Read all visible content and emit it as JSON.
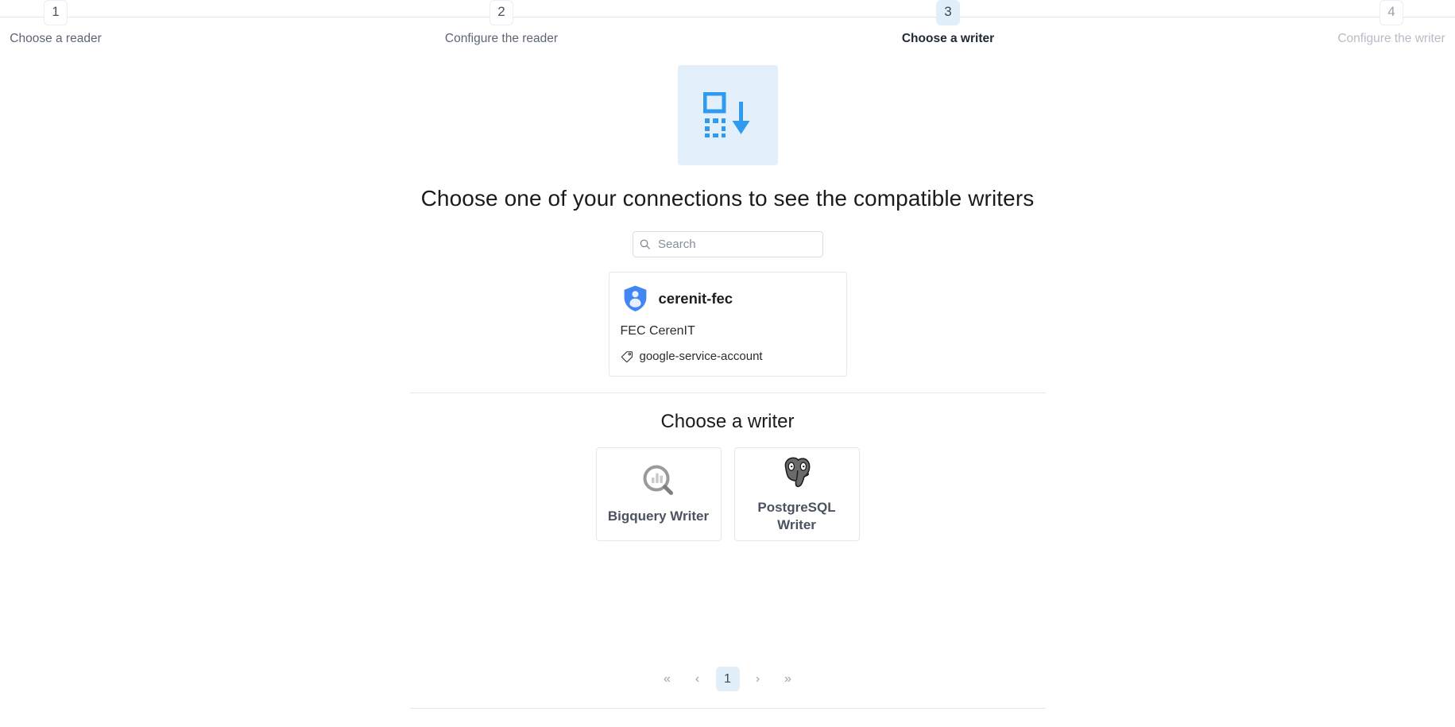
{
  "stepper": {
    "steps": [
      {
        "number": "1",
        "label": "Choose a reader",
        "state": "done"
      },
      {
        "number": "2",
        "label": "Configure the reader",
        "state": "done"
      },
      {
        "number": "3",
        "label": "Choose a writer",
        "state": "active"
      },
      {
        "number": "4",
        "label": "Configure the writer",
        "state": "upcoming"
      }
    ]
  },
  "hero": {
    "icon": "dataset-download-icon",
    "background_color": "#e3f0fc",
    "accent_color": "#2e9bf0"
  },
  "main": {
    "title": "Choose one of your connections to see the compatible writers",
    "search": {
      "placeholder": "Search",
      "value": "",
      "icon": "search-icon"
    },
    "connections": [
      {
        "icon": "shield-user-icon",
        "name": "cerenit-fec",
        "description": "FEC CerenIT",
        "tag_icon": "tag-icon",
        "tag": "google-service-account"
      }
    ],
    "writers_section_title": "Choose a writer",
    "writers": [
      {
        "icon": "bigquery-icon",
        "label": "Bigquery Writer"
      },
      {
        "icon": "postgresql-elephant-icon",
        "label": "PostgreSQL Writer"
      }
    ]
  },
  "pagination": {
    "first_label": "«",
    "prev_label": "‹",
    "pages": [
      "1"
    ],
    "current_page": "1",
    "next_label": "›",
    "last_label": "»",
    "active_background": "#e1effb"
  }
}
